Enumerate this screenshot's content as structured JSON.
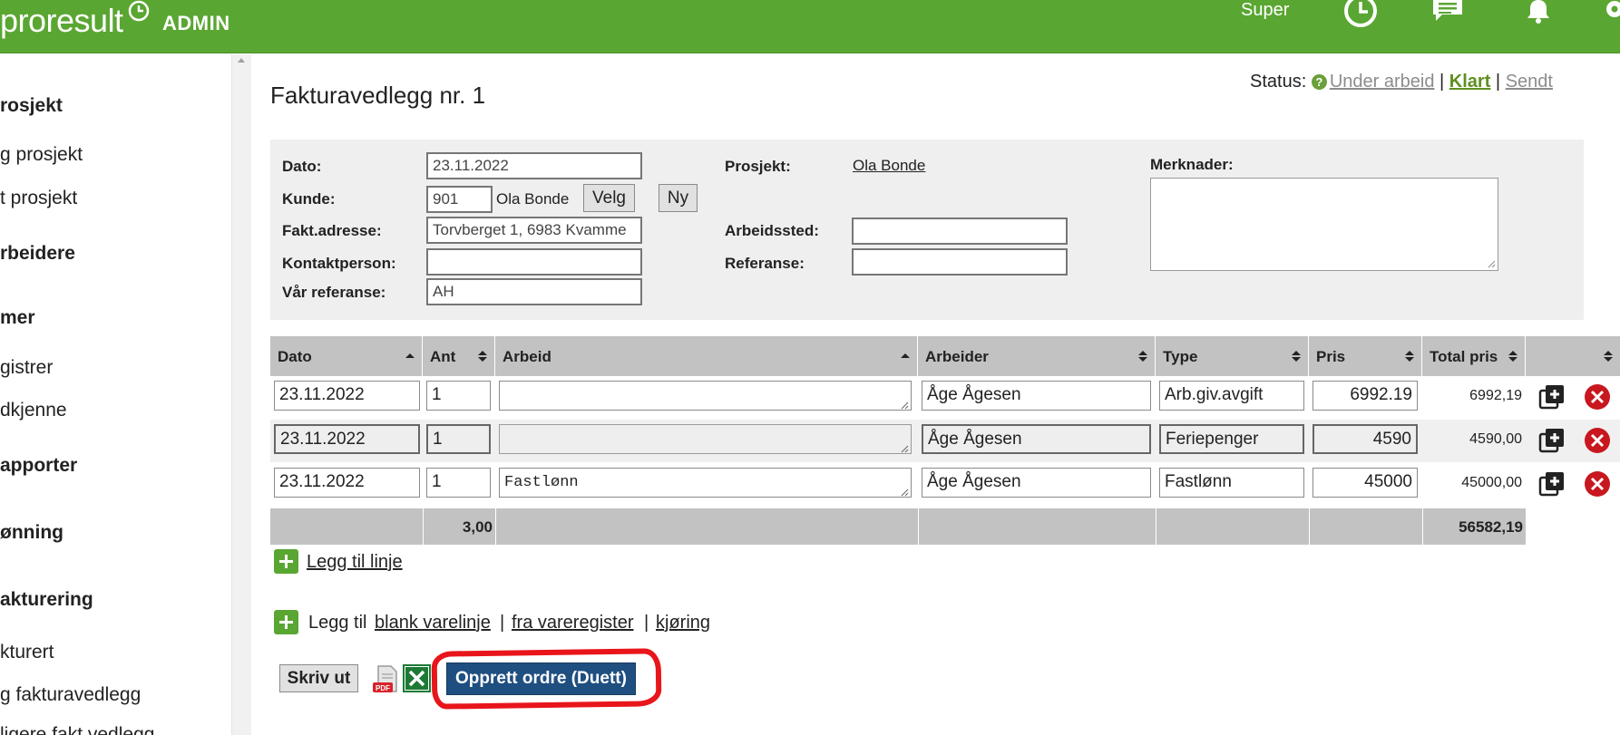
{
  "header": {
    "brand": "proresult",
    "admin_label": "ADMIN",
    "user": "Super",
    "icons": [
      "clock-icon",
      "chat-icon",
      "bell-icon",
      "gear-icon"
    ],
    "color": "#5aa632"
  },
  "sidebar": {
    "items": [
      {
        "label": "rosjekt",
        "heading": true
      },
      {
        "label": "g prosjekt",
        "heading": false
      },
      {
        "label": "t prosjekt",
        "heading": false
      },
      {
        "label": "rbeidere",
        "heading": true
      },
      {
        "label": "mer",
        "heading": true
      },
      {
        "label": "gistrer",
        "heading": false
      },
      {
        "label": "dkjenne",
        "heading": false
      },
      {
        "label": "apporter",
        "heading": true
      },
      {
        "label": "ønning",
        "heading": true
      },
      {
        "label": "akturering",
        "heading": true
      },
      {
        "label": "kturert",
        "heading": false
      },
      {
        "label": "g fakturavedlegg",
        "heading": false
      },
      {
        "label": "ligere fakt.vedlegg",
        "heading": false
      }
    ]
  },
  "page": {
    "title": "Fakturavedlegg nr. 1",
    "status_label": "Status:",
    "status_options": [
      "Under arbeid",
      "Klart",
      "Sendt"
    ],
    "status_active": "Klart",
    "separator": "|"
  },
  "form": {
    "dato_label": "Dato:",
    "dato_value": "23.11.2022",
    "kunde_label": "Kunde:",
    "kunde_nr": "901",
    "kunde_navn": "Ola Bonde",
    "velg_label": "Velg",
    "ny_label": "Ny",
    "adresse_label": "Fakt.adresse:",
    "adresse_value": "Torvberget 1, 6983 Kvamme",
    "kontakt_label": "Kontaktperson:",
    "kontakt_value": "",
    "var_ref_label": "Vår referanse:",
    "var_ref_value": "AH",
    "prosjekt_label": "Prosjekt:",
    "prosjekt_value": "Ola Bonde",
    "arbeidssted_label": "Arbeidssted:",
    "arbeidssted_value": "",
    "referanse_label": "Referanse:",
    "referanse_value": "",
    "merknader_label": "Merknader:",
    "merknader_value": ""
  },
  "table": {
    "headers": [
      "Dato",
      "Ant",
      "Arbeid",
      "Arbeider",
      "Type",
      "Pris",
      "Total pris",
      ""
    ],
    "rows": [
      {
        "dato": "23.11.2022",
        "ant": "1",
        "arbeid": "",
        "arbeider": "Åge Ågesen",
        "type": "Arb.giv.avgift",
        "pris": "6992.19",
        "total": "6992,19"
      },
      {
        "dato": "23.11.2022",
        "ant": "1",
        "arbeid": "",
        "arbeider": "Åge Ågesen",
        "type": "Feriepenger",
        "pris": "4590",
        "total": "4590,00"
      },
      {
        "dato": "23.11.2022",
        "ant": "1",
        "arbeid": "Fastlønn",
        "arbeider": "Åge Ågesen",
        "type": "Fastlønn",
        "pris": "45000",
        "total": "45000,00"
      }
    ],
    "sum_ant": "3,00",
    "sum_total": "56582,19"
  },
  "actions": {
    "legg_til_linje": "Legg til linje",
    "legg_til": "Legg til",
    "blank_varelinje": "blank varelinje",
    "fra_vareregister": "fra vareregister",
    "kjoring": "kjøring",
    "sep": "|",
    "skriv_ut": "Skriv ut",
    "opprett_ordre": "Opprett ordre (Duett)",
    "pdf_badge": "PDF"
  }
}
